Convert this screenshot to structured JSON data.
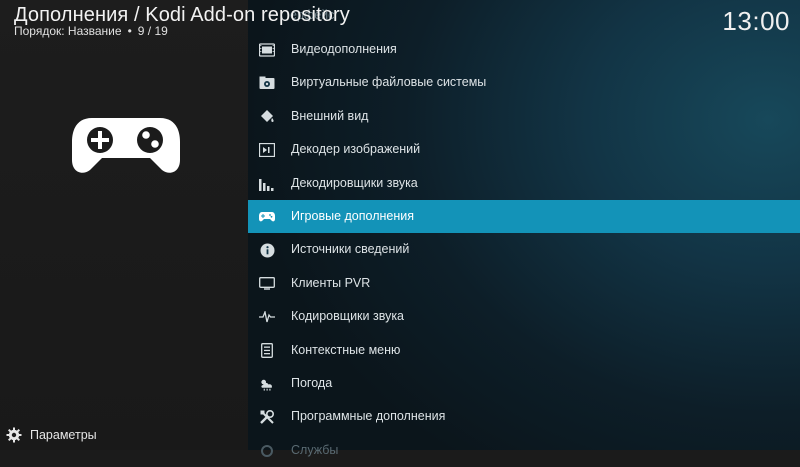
{
  "header": {
    "title": "Дополнения / Kodi Add-on repository",
    "sort_label": "Порядок: Название",
    "separator": "•",
    "position": "9 / 19"
  },
  "clock": "13:00",
  "list": {
    "hidden_item": "ерфейс",
    "items": [
      {
        "label": "Видеодополнения",
        "icon": "video-addon-icon"
      },
      {
        "label": "Виртуальные файловые системы",
        "icon": "vfs-icon"
      },
      {
        "label": "Внешний вид",
        "icon": "paint-bucket-icon"
      },
      {
        "label": "Декодер изображений",
        "icon": "image-decoder-icon"
      },
      {
        "label": "Декодировщики звука",
        "icon": "audio-decoder-icon"
      },
      {
        "label": "Игровые дополнения",
        "icon": "gamepad-icon",
        "selected": true
      },
      {
        "label": "Источники сведений",
        "icon": "info-icon"
      },
      {
        "label": "Клиенты PVR",
        "icon": "tv-icon"
      },
      {
        "label": "Кодировщики звука",
        "icon": "waveform-icon"
      },
      {
        "label": "Контекстные меню",
        "icon": "context-menu-icon"
      },
      {
        "label": "Погода",
        "icon": "weather-icon"
      },
      {
        "label": "Программные дополнения",
        "icon": "tools-icon"
      },
      {
        "label": "Службы",
        "icon": "services-icon",
        "faded": true
      }
    ]
  },
  "preview_icon": "gamepad-icon",
  "footer": {
    "settings_label": "Параметры",
    "settings_icon": "gear-icon"
  },
  "colors": {
    "selected_bg": "#1393b8",
    "panel_left": "#1b1b1b",
    "panel_right": "#123445"
  }
}
